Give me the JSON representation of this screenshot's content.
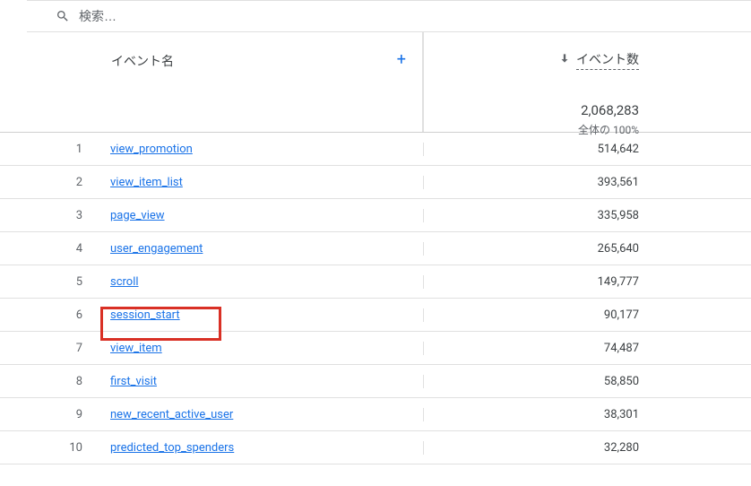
{
  "search": {
    "placeholder": "検索…"
  },
  "columns": {
    "name_label": "イベント名",
    "count_label": "イベント数"
  },
  "totals": {
    "value": "2,068,283",
    "percent": "全体の 100%"
  },
  "icons": {
    "plus": "+"
  },
  "rows": [
    {
      "rank": "1",
      "name": "view_promotion",
      "count": "514,642",
      "highlighted": false
    },
    {
      "rank": "2",
      "name": "view_item_list",
      "count": "393,561",
      "highlighted": false
    },
    {
      "rank": "3",
      "name": "page_view",
      "count": "335,958",
      "highlighted": false
    },
    {
      "rank": "4",
      "name": "user_engagement",
      "count": "265,640",
      "highlighted": false
    },
    {
      "rank": "5",
      "name": "scroll",
      "count": "149,777",
      "highlighted": false
    },
    {
      "rank": "6",
      "name": "session_start",
      "count": "90,177",
      "highlighted": true
    },
    {
      "rank": "7",
      "name": "view_item",
      "count": "74,487",
      "highlighted": false
    },
    {
      "rank": "8",
      "name": "first_visit",
      "count": "58,850",
      "highlighted": false
    },
    {
      "rank": "9",
      "name": "new_recent_active_user",
      "count": "38,301",
      "highlighted": false
    },
    {
      "rank": "10",
      "name": "predicted_top_spenders",
      "count": "32,280",
      "highlighted": false
    }
  ]
}
